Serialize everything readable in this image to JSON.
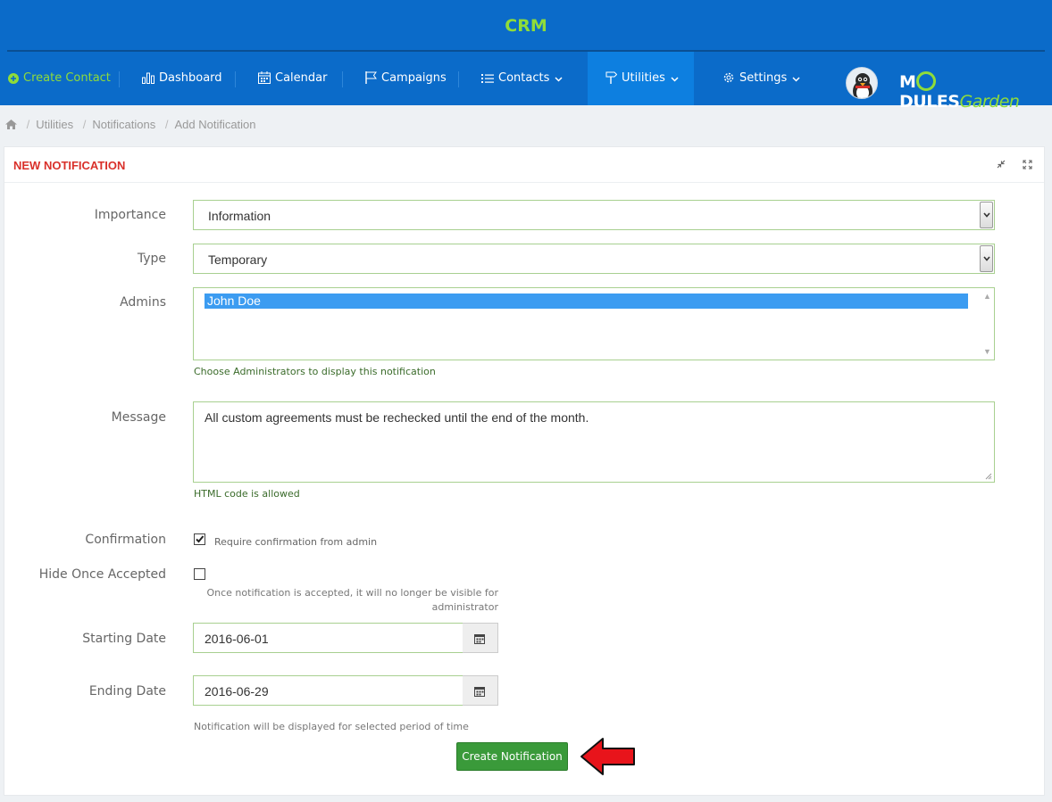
{
  "app": {
    "title": "CRM"
  },
  "nav": {
    "create_contact": "Create Contact",
    "dashboard": "Dashboard",
    "calendar": "Calendar",
    "campaigns": "Campaigns",
    "contacts": "Contacts",
    "utilities": "Utilities",
    "settings": "Settings"
  },
  "brand": {
    "part1": "M",
    "part2": "DULES",
    "part3": "Garden"
  },
  "breadcrumb": [
    "Utilities",
    "Notifications",
    "Add Notification"
  ],
  "card": {
    "title": "NEW NOTIFICATION"
  },
  "form": {
    "importance": {
      "label": "Importance",
      "value": "Information"
    },
    "type": {
      "label": "Type",
      "value": "Temporary"
    },
    "admins": {
      "label": "Admins",
      "selected": "John Doe",
      "help": "Choose Administrators to display this notification"
    },
    "message": {
      "label": "Message",
      "value": "All custom agreements must be rechecked until the end of the month.",
      "help": "HTML code is allowed"
    },
    "confirmation": {
      "label": "Confirmation",
      "checkbox_label": "Require confirmation from admin",
      "checked": true
    },
    "hide_once_accepted": {
      "label": "Hide Once Accepted",
      "help_line1": "Once notification is accepted, it will no longer be visible for",
      "help_line2": "administrator",
      "checked": false
    },
    "starting_date": {
      "label": "Starting Date",
      "value": "2016-06-01"
    },
    "ending_date": {
      "label": "Ending Date",
      "value": "2016-06-29",
      "help": "Notification will be displayed for selected period of time"
    },
    "submit_label": "Create Notification"
  },
  "colors": {
    "header_bg": "#0b6bc9",
    "accent_green": "#8fdc3a",
    "title_red": "#d9302a",
    "button_green": "#3a9a3a",
    "annotation_red": "#e8141b"
  }
}
